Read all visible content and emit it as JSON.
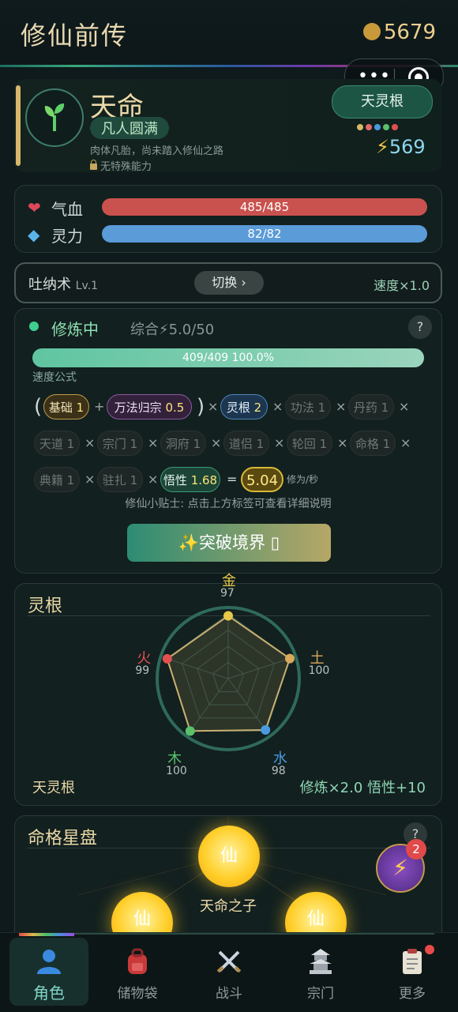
{
  "header": {
    "title": "修仙前传",
    "coins": "5679"
  },
  "profile": {
    "name": "天命",
    "realm": "凡人圆满",
    "description": "肉体凡胎，尚未踏入修仙之路",
    "ability": "无特殊能力",
    "root_type": "天灵根",
    "power": "569",
    "root_dot_colors": [
      "#d9b86a",
      "#e06a6a",
      "#4a9ae0",
      "#5ac06a",
      "#e05050"
    ]
  },
  "stats": {
    "hp_label": "气血",
    "hp_value": "485/485",
    "mp_label": "灵力",
    "mp_value": "82/82"
  },
  "technique": {
    "name": "吐纳术",
    "level": "Lv.1",
    "switch_label": "切换 ›",
    "speed": "速度×1.0"
  },
  "cultivation": {
    "status": "修炼中",
    "total": "综合⚡5.0/50",
    "help": "?",
    "progress_text": "409/409  100.0%",
    "progress_fraction": 1.0,
    "formula_label": "速度公式",
    "chips": {
      "base_name": "基础",
      "base_val": "1",
      "sect_name": "万法归宗",
      "sect_val": "0.5",
      "root_name": "灵根",
      "root_val": "2",
      "gongfa": "功法 1",
      "danyao": "丹药 1",
      "tiandao": "天道 1",
      "zongmen": "宗门 1",
      "dongfu": "洞府 1",
      "daolv": "道侣 1",
      "lunhui": "轮回 1",
      "mingge": "命格 1",
      "dianji": "典籍 1",
      "zhuzha": "驻扎 1",
      "wuxing_name": "悟性",
      "wuxing_val": "1.68",
      "result": "5.04",
      "unit": "修为/秒"
    },
    "operators": {
      "open": "(",
      "close": ")",
      "plus": "+",
      "times": "×",
      "equals": "="
    },
    "tip": "修仙小贴士: 点击上方标签可查看详细说明",
    "breakthrough": "✨突破境界 ▯"
  },
  "spirit_roots": {
    "title": "灵根",
    "elements": [
      {
        "name": "金",
        "value": 97,
        "color": "#e8c84a"
      },
      {
        "name": "土",
        "value": 100,
        "color": "#d9a85a"
      },
      {
        "name": "水",
        "value": 98,
        "color": "#4a9ae0"
      },
      {
        "name": "木",
        "value": 100,
        "color": "#5ac06a"
      },
      {
        "name": "火",
        "value": 99,
        "color": "#e05050"
      }
    ],
    "footer_type": "天灵根",
    "footer_bonus": "修炼×2.0  悟性+10"
  },
  "star_chart": {
    "title": "命格星盘",
    "help": "?",
    "center_label": "天命之子",
    "orb_char": "仙",
    "fab_badge": "2"
  },
  "tabbar": {
    "tabs": [
      {
        "label": "角色",
        "icon": "person-icon"
      },
      {
        "label": "储物袋",
        "icon": "backpack-icon"
      },
      {
        "label": "战斗",
        "icon": "swords-icon"
      },
      {
        "label": "宗门",
        "icon": "pagoda-icon"
      },
      {
        "label": "更多",
        "icon": "clipboard-icon"
      }
    ]
  }
}
